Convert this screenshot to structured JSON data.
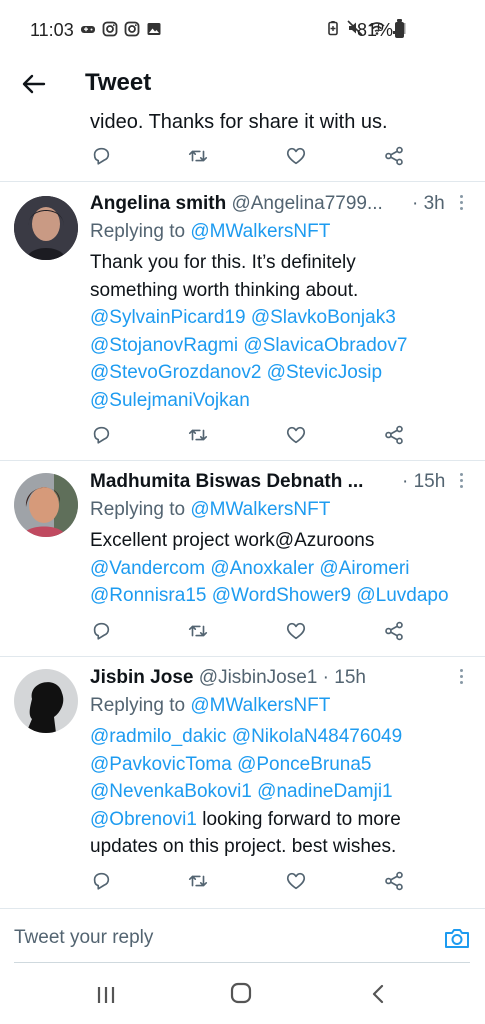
{
  "status_bar": {
    "time": "11:03",
    "battery": "81%",
    "left_icons": [
      "game-controller-icon",
      "instagram-icon",
      "instagram-icon",
      "image-icon"
    ],
    "right_icons": [
      "battery-saver-icon",
      "mute-icon",
      "wifi-icon",
      "signal-icon"
    ]
  },
  "header": {
    "title": "Tweet"
  },
  "partial_tweet": {
    "text": "video. Thanks for share it with us."
  },
  "tweets": [
    {
      "name": "Angelina smith",
      "handle": "@Angelina7799...",
      "time": "· 3h",
      "replying_prefix": "Replying to ",
      "replying_to": "@MWalkersNFT",
      "body_lines": [
        [
          {
            "t": "Thank you for this. It’s definitely",
            "link": false
          }
        ],
        [
          {
            "t": "something worth thinking about.",
            "link": false
          }
        ],
        [
          {
            "t": "@SylvainPicard19",
            "link": true
          },
          {
            "t": " ",
            "link": false
          },
          {
            "t": "@SlavkoBonjak3",
            "link": true
          }
        ],
        [
          {
            "t": "@StojanovRagmi",
            "link": true
          },
          {
            "t": " ",
            "link": false
          },
          {
            "t": "@SlavicaObradov7",
            "link": true
          }
        ],
        [
          {
            "t": "@StevoGrozdanov2",
            "link": true
          },
          {
            "t": " ",
            "link": false
          },
          {
            "t": "@StevicJosip",
            "link": true
          }
        ],
        [
          {
            "t": "@SulejmaniVojkan",
            "link": true
          }
        ]
      ]
    },
    {
      "name": "Madhumita Biswas Debnath ...",
      "handle": "",
      "time": "· 15h",
      "replying_prefix": "Replying to ",
      "replying_to": "@MWalkersNFT",
      "body_lines": [
        [
          {
            "t": "Excellent project work@Azuroons",
            "link": false
          }
        ],
        [
          {
            "t": "@Vandercom",
            "link": true
          },
          {
            "t": " ",
            "link": false
          },
          {
            "t": "@Anoxkaler",
            "link": true
          },
          {
            "t": " ",
            "link": false
          },
          {
            "t": "@Airomeri",
            "link": true
          }
        ],
        [
          {
            "t": "@Ronnisra15",
            "link": true
          },
          {
            "t": " ",
            "link": false
          },
          {
            "t": "@WordShower9",
            "link": true
          },
          {
            "t": " ",
            "link": false
          },
          {
            "t": "@Luvdapo",
            "link": true
          }
        ]
      ]
    },
    {
      "name": "Jisbin Jose",
      "handle": "@JisbinJose1",
      "time": "· 15h",
      "replying_prefix": "Replying to ",
      "replying_to": "@MWalkersNFT",
      "body_lines": [
        [
          {
            "t": "@radmilo_dakic",
            "link": true
          },
          {
            "t": " ",
            "link": false
          },
          {
            "t": "@NikolaN48476049",
            "link": true
          }
        ],
        [
          {
            "t": "@PavkovicToma",
            "link": true
          },
          {
            "t": " ",
            "link": false
          },
          {
            "t": "@PonceBruna5",
            "link": true
          }
        ],
        [
          {
            "t": "@NevenkaBokovi1",
            "link": true
          },
          {
            "t": " ",
            "link": false
          },
          {
            "t": "@nadineDamji1",
            "link": true
          }
        ],
        [
          {
            "t": "@Obrenovi1",
            "link": true
          },
          {
            "t": " looking forward to more",
            "link": false
          }
        ],
        [
          {
            "t": "updates on this project. best wishes.",
            "link": false
          }
        ]
      ]
    }
  ],
  "reply_bar": {
    "placeholder": "Tweet your reply"
  },
  "colors": {
    "accent": "#1d9bf0",
    "secondary_text": "#536471",
    "primary_text": "#0f1419",
    "divider": "#e1e8ed"
  }
}
